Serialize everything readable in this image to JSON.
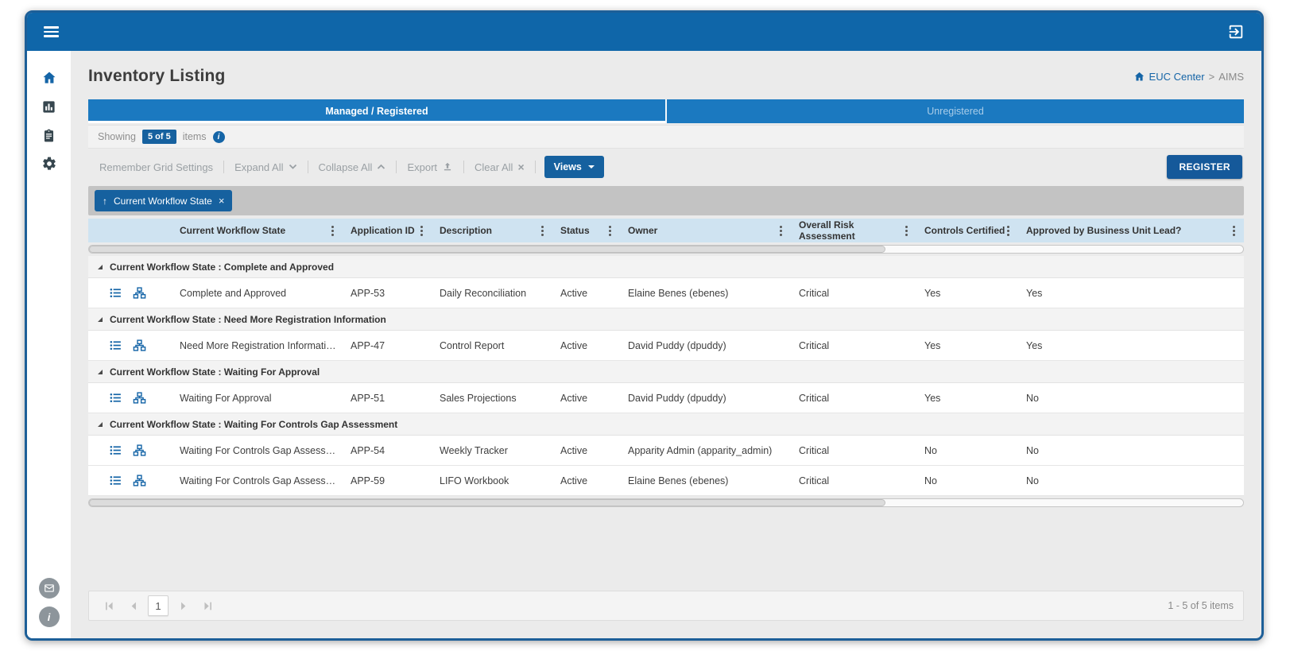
{
  "icons": {
    "menu": "hamburger-three-bars",
    "logout": "exit-to-app-arrow",
    "sidebar_home": "house",
    "sidebar_analytics": "bar-chart-square",
    "sidebar_inventory": "clipboard",
    "sidebar_settings": "gear",
    "sidebar_mail": "envelope-circle",
    "info": "i",
    "column_menu": "vertical-ellipsis-dots",
    "sort_asc": "↑",
    "chip_close": "×",
    "clear_all": "✖",
    "group_toggle": "corner-triangle",
    "row_details": "list-lines",
    "row_hierarchy": "sitemap"
  },
  "header": {
    "title": "Inventory Listing",
    "breadcrumb": {
      "link": "EUC Center",
      "separator": ">",
      "current": "AIMS"
    }
  },
  "tabs": {
    "managed": "Managed / Registered",
    "unregistered": "Unregistered"
  },
  "showing": {
    "label": "Showing",
    "count": "5 of 5",
    "suffix": "items"
  },
  "toolbar": {
    "remember": "Remember Grid Settings",
    "expand": "Expand All",
    "collapse": "Collapse All",
    "export": "Export",
    "clear": "Clear All",
    "views": "Views",
    "register": "REGISTER"
  },
  "group_bar": {
    "chip_label": "Current Workflow State"
  },
  "table": {
    "columns": [
      "Current Workflow State",
      "Application ID",
      "Description",
      "Status",
      "Owner",
      "Overall Risk Assessment",
      "Controls Certified",
      "Approved by Business Unit Lead?"
    ],
    "groups": [
      {
        "label": "Current Workflow State : Complete and Approved",
        "rows": [
          {
            "cells": [
              "Complete and Approved",
              "APP-53",
              "Daily Reconciliation",
              "Active",
              "Elaine Benes (ebenes)",
              "Critical",
              "Yes",
              "Yes"
            ]
          }
        ]
      },
      {
        "label": "Current Workflow State : Need More Registration Information",
        "rows": [
          {
            "cells": [
              "Need More Registration Information",
              "APP-47",
              "Control Report",
              "Active",
              "David Puddy (dpuddy)",
              "Critical",
              "Yes",
              "Yes"
            ]
          }
        ]
      },
      {
        "label": "Current Workflow State : Waiting For Approval",
        "rows": [
          {
            "cells": [
              "Waiting For Approval",
              "APP-51",
              "Sales Projections",
              "Active",
              "David Puddy (dpuddy)",
              "Critical",
              "Yes",
              "No"
            ]
          }
        ]
      },
      {
        "label": "Current Workflow State : Waiting For Controls Gap Assessment",
        "rows": [
          {
            "cells": [
              "Waiting For Controls Gap Assessment",
              "APP-54",
              "Weekly Tracker",
              "Active",
              "Apparity Admin (apparity_admin)",
              "Critical",
              "No",
              "No"
            ]
          },
          {
            "cells": [
              "Waiting For Controls Gap Assessment",
              "APP-59",
              "LIFO Workbook",
              "Active",
              "Elaine Benes (ebenes)",
              "Critical",
              "No",
              "No"
            ]
          }
        ]
      }
    ]
  },
  "pagination": {
    "page": "1",
    "summary": "1 - 5 of 5 items"
  },
  "colors": {
    "frame_border": "#1d5f98",
    "topbar": "#0f66a9",
    "tab_bar": "#1b79c0",
    "accent": "#16619f",
    "link": "#1565a7",
    "table_header_bg": "#cfe3f1",
    "group_bar_bg": "#c3c3c3"
  }
}
